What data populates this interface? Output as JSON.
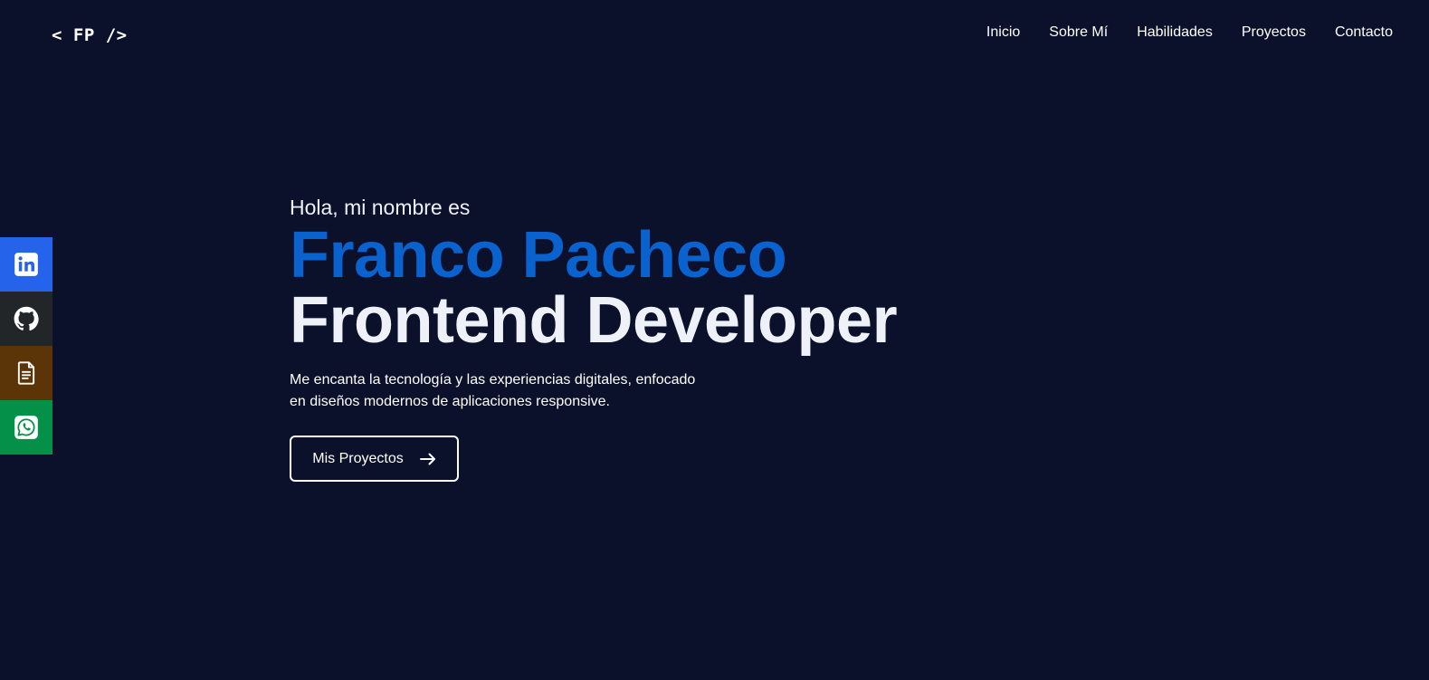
{
  "header": {
    "logo": "< FP />",
    "nav": [
      "Inicio",
      "Sobre Mí",
      "Habilidades",
      "Proyectos",
      "Contacto"
    ]
  },
  "social": [
    {
      "name": "linkedin-icon",
      "color": "#2563eb"
    },
    {
      "name": "github-icon",
      "color": "#232629"
    },
    {
      "name": "document-icon",
      "color": "#5b3408"
    },
    {
      "name": "whatsapp-icon",
      "color": "#05904a"
    }
  ],
  "hero": {
    "greeting": "Hola, mi nombre es",
    "name": "Franco Pacheco",
    "role": "Frontend Developer",
    "description": "Me encanta la tecnología y las experiencias digitales, enfocado en diseños modernos de aplicaciones responsive.",
    "cta_label": "Mis Proyectos",
    "cta_icon": "arrow-right-icon"
  },
  "colors": {
    "background": "#0b112b",
    "accent": "#0a62cf",
    "text": "#eef1f7"
  }
}
